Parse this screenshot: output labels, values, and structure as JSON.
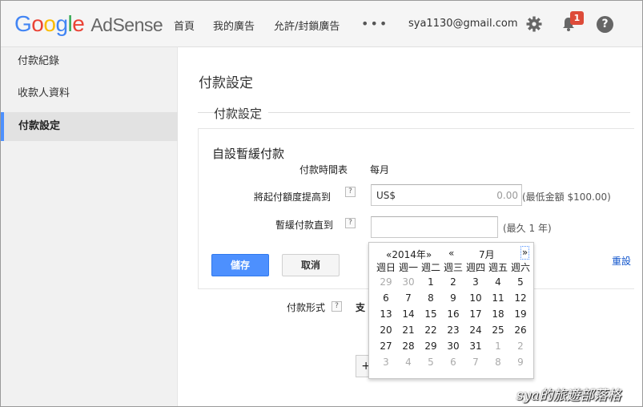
{
  "header": {
    "logo_google": [
      "G",
      "o",
      "o",
      "g",
      "l",
      "e"
    ],
    "logo_product": "AdSense",
    "nav": [
      "首頁",
      "我的廣告",
      "允許/封鎖廣告"
    ],
    "more": "•••",
    "email": "sya1130@gmail.com",
    "notification_count": "1",
    "help": "?"
  },
  "sidebar": {
    "items": [
      "付款紀錄",
      "收款人資料",
      "付款設定"
    ],
    "active_index": 2
  },
  "main": {
    "page_title": "付款設定",
    "section_title": "付款設定",
    "panel_title": "自設暫緩付款",
    "schedule_label": "付款時間表",
    "schedule_value": "每月",
    "threshold_label": "將起付額度提高到",
    "threshold_prefix": "US$",
    "threshold_value": "0.00",
    "threshold_hint": "(最低金額 $100.00)",
    "hold_label": "暫緩付款直到",
    "hold_value": "",
    "hold_hint": "(最久 1 年)",
    "qmark": "?",
    "save_label": "儲存",
    "cancel_label": "取消",
    "reset_label": "重設",
    "paytype_label": "付款形式",
    "paytype_value": "支",
    "add_label": "+"
  },
  "calendar": {
    "year": "«2014年»",
    "prev": "«",
    "month": "7月",
    "next": "»",
    "weekdays": [
      "週日",
      "週一",
      "週二",
      "週三",
      "週四",
      "週五",
      "週六"
    ],
    "weeks": [
      [
        {
          "d": "29",
          "o": true
        },
        {
          "d": "30",
          "o": true
        },
        {
          "d": "1"
        },
        {
          "d": "2"
        },
        {
          "d": "3"
        },
        {
          "d": "4"
        },
        {
          "d": "5"
        }
      ],
      [
        {
          "d": "6"
        },
        {
          "d": "7"
        },
        {
          "d": "8"
        },
        {
          "d": "9"
        },
        {
          "d": "10"
        },
        {
          "d": "11"
        },
        {
          "d": "12"
        }
      ],
      [
        {
          "d": "13"
        },
        {
          "d": "14"
        },
        {
          "d": "15"
        },
        {
          "d": "16"
        },
        {
          "d": "17"
        },
        {
          "d": "18"
        },
        {
          "d": "19"
        }
      ],
      [
        {
          "d": "20"
        },
        {
          "d": "21"
        },
        {
          "d": "22"
        },
        {
          "d": "23"
        },
        {
          "d": "24"
        },
        {
          "d": "25"
        },
        {
          "d": "26"
        }
      ],
      [
        {
          "d": "27"
        },
        {
          "d": "28"
        },
        {
          "d": "29"
        },
        {
          "d": "30"
        },
        {
          "d": "31"
        },
        {
          "d": "1",
          "o": true
        },
        {
          "d": "2",
          "o": true
        }
      ],
      [
        {
          "d": "3",
          "o": true
        },
        {
          "d": "4",
          "o": true
        },
        {
          "d": "5",
          "o": true
        },
        {
          "d": "6",
          "o": true
        },
        {
          "d": "7",
          "o": true
        },
        {
          "d": "8",
          "o": true
        },
        {
          "d": "9",
          "o": true
        }
      ]
    ]
  },
  "watermark": "sya的旅遊部落格",
  "colors": {
    "accent": "#4d90fe",
    "badge": "#dd4b39",
    "link": "#1155cc"
  }
}
